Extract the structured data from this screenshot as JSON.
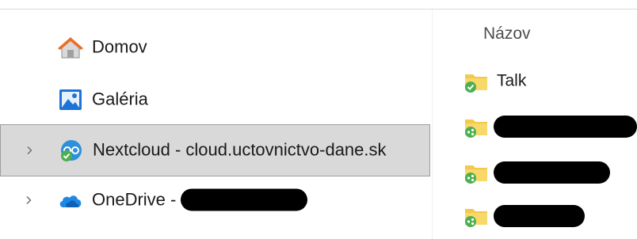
{
  "nav": {
    "items": [
      {
        "label": "Domov",
        "icon": "home-icon",
        "expandable": false,
        "selected": false
      },
      {
        "label": "Galéria",
        "icon": "gallery-icon",
        "expandable": false,
        "selected": false
      },
      {
        "label": "Nextcloud - cloud.uctovnictvo-dane.sk",
        "icon": "nextcloud-icon",
        "expandable": true,
        "selected": true
      },
      {
        "label": "OneDrive - ",
        "icon": "onedrive-icon",
        "expandable": true,
        "selected": false,
        "redacted_suffix": true
      }
    ]
  },
  "list": {
    "column_header": "Názov",
    "rows": [
      {
        "label": "Talk",
        "icon": "folder-synced-icon",
        "redacted": false
      },
      {
        "label": "",
        "icon": "folder-shared-icon",
        "redacted": true
      },
      {
        "label": "",
        "icon": "folder-shared-icon",
        "redacted": true
      },
      {
        "label": "",
        "icon": "folder-shared-icon",
        "redacted": true
      }
    ]
  },
  "colors": {
    "selection_bg": "#d9d9d9",
    "selection_border": "#9e9e9e",
    "folder_yellow": "#f2c94c",
    "sync_green": "#4caf50",
    "onedrive_blue": "#1e88e5",
    "redaction": "#000000"
  }
}
